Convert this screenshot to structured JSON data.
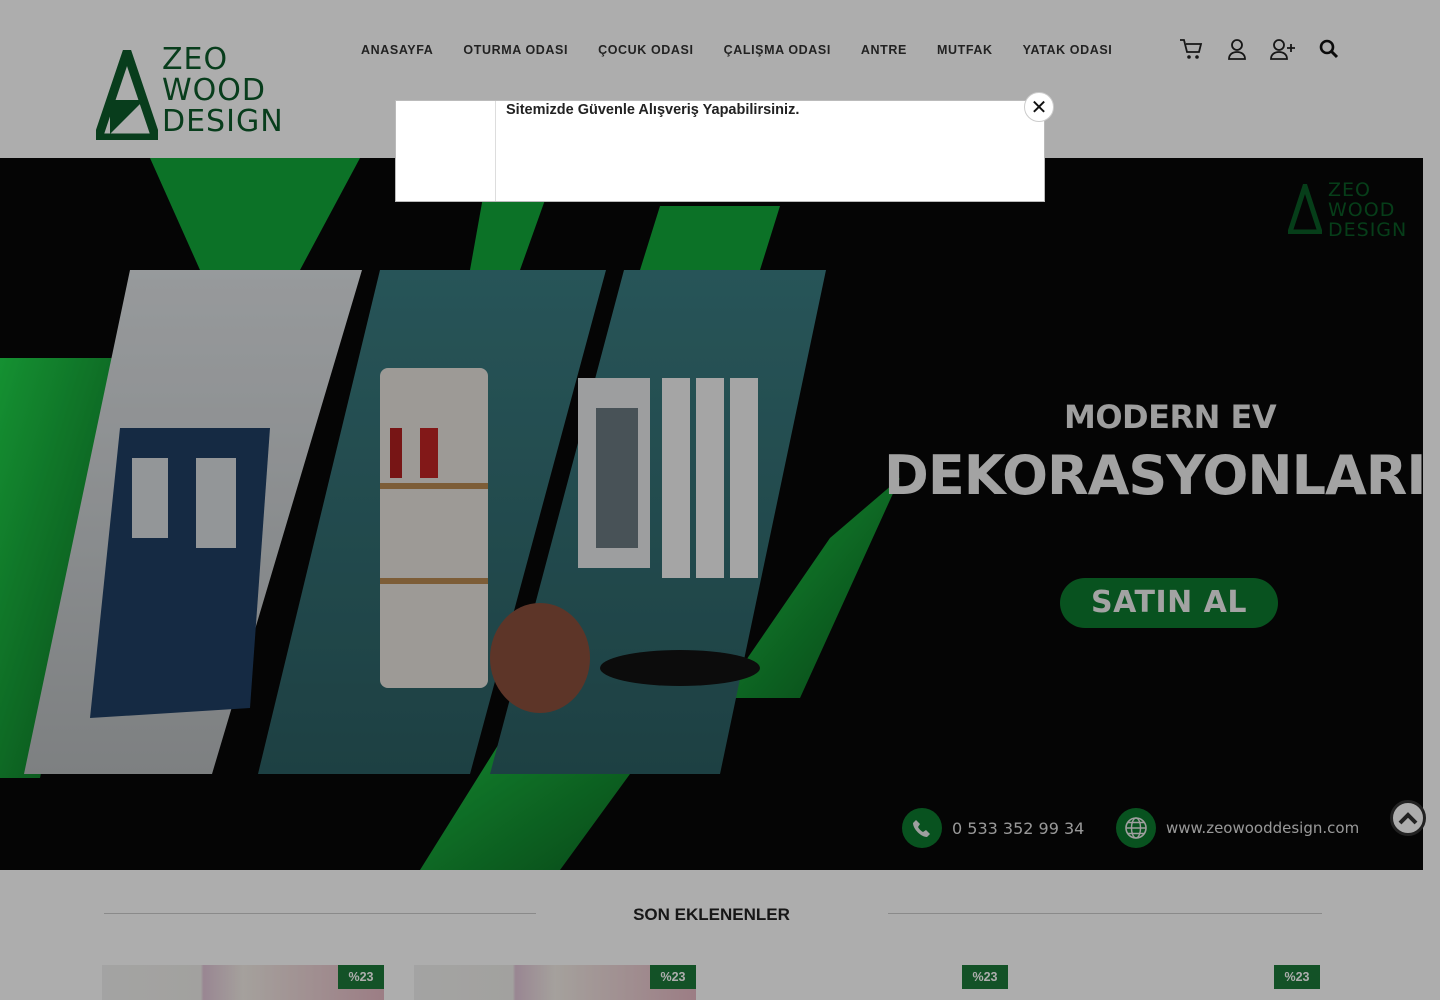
{
  "header": {
    "logo_lines": [
      "ZEO",
      "WOOD",
      "DESIGN"
    ],
    "nav": [
      "ANASAYFA",
      "OTURMA ODASI",
      "ÇOCUK ODASI",
      "ÇALIŞMA ODASI",
      "ANTRE",
      "MUTFAK",
      "YATAK ODASI"
    ],
    "icons": [
      "cart-icon",
      "user-icon",
      "user-plus-icon",
      "search-icon"
    ]
  },
  "popup": {
    "message": "Sitemizde Güvenle Alışveriş Yapabilirsiniz.",
    "close_label": "✕"
  },
  "banner": {
    "logo_lines": [
      "ZEO",
      "WOOD",
      "DESIGN"
    ],
    "title_line1": "MODERN EV",
    "title_line2": "DEKORASYONLARI",
    "button_label": "SATIN AL",
    "phone": "0 533 352 99 34",
    "website": "www.zeowooddesign.com"
  },
  "section": {
    "title": "SON EKLENENLER"
  },
  "products": [
    {
      "badge": "%23"
    },
    {
      "badge": "%23"
    },
    {
      "badge": "%23"
    },
    {
      "badge": "%23"
    }
  ],
  "colors": {
    "brand_green": "#0d5a2a",
    "badge_green": "#1d7a3a",
    "banner_green": "#0d7a2e"
  }
}
